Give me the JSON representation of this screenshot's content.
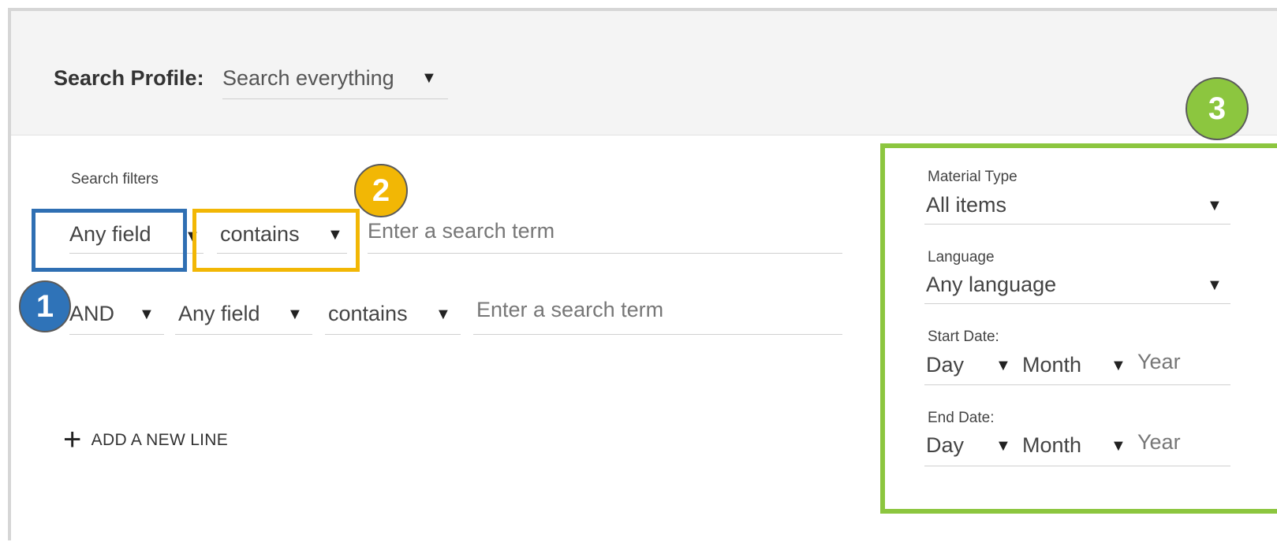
{
  "profile": {
    "label": "Search Profile:",
    "selected": "Search everything"
  },
  "filters": {
    "section_label": "Search filters",
    "row1": {
      "field": "Any field",
      "operator": "contains",
      "term_placeholder": "Enter a search term"
    },
    "row2": {
      "boolean": "AND",
      "field": "Any field",
      "operator": "contains",
      "term_placeholder": "Enter a search term"
    },
    "add_line_label": "ADD A NEW LINE"
  },
  "side": {
    "material_type": {
      "label": "Material Type",
      "value": "All items"
    },
    "language": {
      "label": "Language",
      "value": "Any language"
    },
    "start_date": {
      "label": "Start Date:",
      "day": "Day",
      "month": "Month",
      "year": "Year"
    },
    "end_date": {
      "label": "End Date:",
      "day": "Day",
      "month": "Month",
      "year": "Year"
    }
  },
  "badges": {
    "one": "1",
    "two": "2",
    "three": "3"
  },
  "colors": {
    "blue": "#2f6fb3",
    "yellow": "#f2b705",
    "green": "#8cc63f"
  },
  "icons": {
    "dropdown": "caret-down-icon",
    "add": "plus-icon"
  }
}
